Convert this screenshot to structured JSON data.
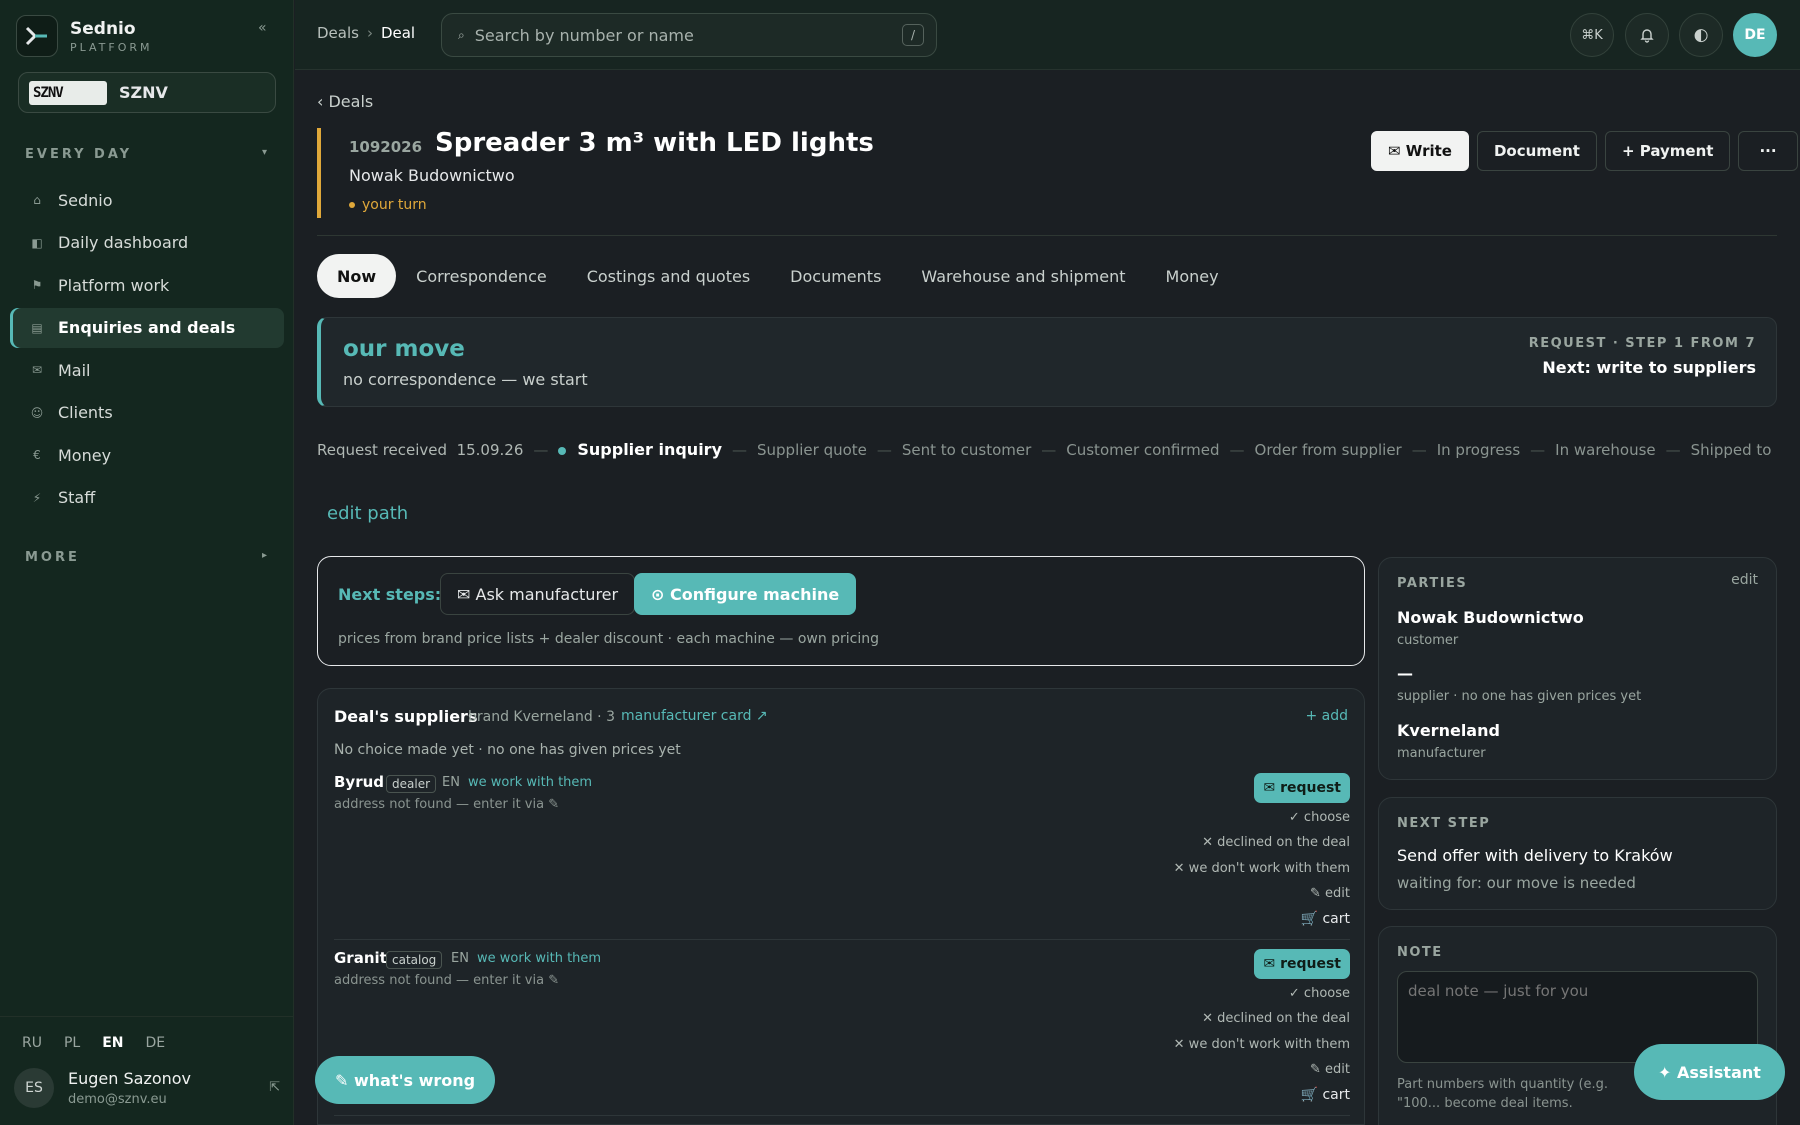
{
  "brand": {
    "name": "Sednio",
    "sub": "PLATFORM",
    "collapse": "«"
  },
  "org": {
    "logo": "SZNV",
    "name": "SZNV"
  },
  "sections": {
    "every_day": "EVERY DAY",
    "more": "MORE",
    "caret_open": "▾",
    "caret_closed": "▸"
  },
  "nav": [
    {
      "icon": "⌂",
      "label": "Sednio"
    },
    {
      "icon": "◧",
      "label": "Daily dashboard"
    },
    {
      "icon": "⚑",
      "label": "Platform work"
    },
    {
      "icon": "▤",
      "label": "Enquiries and deals"
    },
    {
      "icon": "✉",
      "label": "Mail"
    },
    {
      "icon": "☺",
      "label": "Clients"
    },
    {
      "icon": "€",
      "label": "Money"
    },
    {
      "icon": "⚡",
      "label": "Staff"
    }
  ],
  "langs": [
    "RU",
    "PL",
    "EN",
    "DE"
  ],
  "user": {
    "initials": "ES",
    "name": "Eugen Sazonov",
    "email": "demo@sznv.eu",
    "out": "⇱"
  },
  "topbar": {
    "crumbs": [
      "Deals",
      "Deal"
    ],
    "crumb_sep": "›",
    "search_icon": "⌕",
    "search_placeholder": "Search by number or name",
    "search_kbd": "/",
    "cmdk": "⌘K",
    "bell": "🔔",
    "theme": "◐",
    "avatar": "DE"
  },
  "deal": {
    "back": "‹ Deals",
    "number": "1092026",
    "title": "Spreader 3 m³ with LED lights",
    "customer": "Nowak Budownictwo",
    "status": "your turn",
    "actions": [
      "✉ Write",
      "Document",
      "+ Payment",
      "···"
    ]
  },
  "tabs": [
    "Now",
    "Correspondence",
    "Costings and quotes",
    "Documents",
    "Warehouse and shipment",
    "Money"
  ],
  "move": {
    "title": "our move",
    "sub": "no correspondence — we start",
    "step": "REQUEST · STEP 1 FROM 7",
    "next": "Next: write to suppliers"
  },
  "steps": {
    "first": "Request received  15.09.26",
    "current": "Supplier inquiry",
    "rest": [
      "Supplier quote",
      "Sent to customer",
      "Customer confirmed",
      "Order from supplier",
      "In progress",
      "In warehouse",
      "Shipped to customer"
    ]
  },
  "edit_path": "edit path",
  "next_steps": {
    "label": "Next steps:",
    "btn1": "✉ Ask manufacturer",
    "btn2": "⊙ Configure machine",
    "sub": "prices from brand price lists + dealer discount · each machine — own pricing"
  },
  "suppliers": {
    "title": "Deal's suppliers",
    "meta": "brand Kverneland · 3",
    "link": "manufacturer card ↗",
    "add": "+ add",
    "note": "No choice made yet · no one has given prices yet",
    "rows": [
      {
        "name": "Byrud",
        "tag": "dealer",
        "lang": "EN",
        "rel": "we work with them",
        "addr": "address not found — enter it via ✎",
        "request": "✉ request",
        "opts": [
          "✓ choose",
          "✕ declined on the deal",
          "✕ we don't work with them",
          "✎ edit",
          "🛒 cart"
        ]
      },
      {
        "name": "Granit",
        "tag": "catalog",
        "lang": "EN",
        "rel": "we work with them",
        "addr": "address not found — enter it via ✎",
        "request": "✉ request",
        "opts": [
          "✓ choose",
          "✕ declined on the deal",
          "✕ we don't work with them",
          "✎ edit",
          "🛒 cart"
        ]
      }
    ]
  },
  "parties": {
    "title": "PARTIES",
    "edit": "edit",
    "items": [
      {
        "name": "Nowak Budownictwo",
        "role": "customer"
      },
      {
        "name": "—",
        "role": "supplier · no one has given prices yet"
      },
      {
        "name": "Kverneland",
        "role": "manufacturer"
      }
    ]
  },
  "next_step": {
    "title": "NEXT STEP",
    "text": "Send offer with delivery to Kraków",
    "waiting": "waiting for: our move is needed"
  },
  "note": {
    "title": "NOTE",
    "placeholder": "deal note — just for you",
    "hint": "Part numbers with quantity (e.g. \"100... become deal items."
  },
  "fab": "✎ what's wrong",
  "assistant": "✦ Assistant",
  "colors": {
    "accent": "#57b9b6",
    "warn": "#e0a83a",
    "sidebar": "#14271f"
  }
}
